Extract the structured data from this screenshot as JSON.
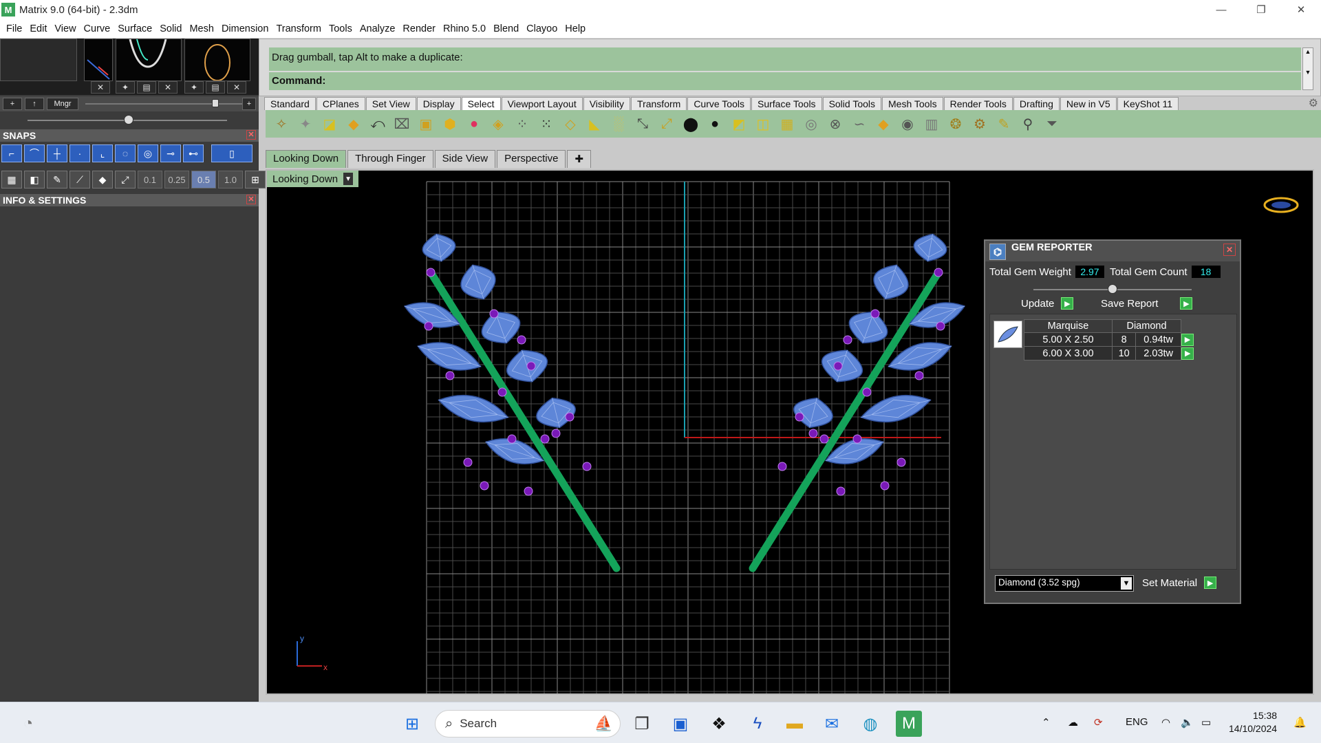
{
  "window": {
    "title": "Matrix 9.0 (64-bit) - 2.3dm",
    "icon_text": "M",
    "minimize": "—",
    "maximize": "❐",
    "close": "✕"
  },
  "menu": [
    "File",
    "Edit",
    "View",
    "Curve",
    "Surface",
    "Solid",
    "Mesh",
    "Dimension",
    "Transform",
    "Tools",
    "Analyze",
    "Render",
    "Rhino 5.0",
    "Blend",
    "Clayoo",
    "Help"
  ],
  "left_panel": {
    "layer_buttons": [
      "+",
      "↑",
      "Mngr"
    ],
    "snaps_title": "SNAPS",
    "snap_values": [
      "0.1",
      "0.25",
      "0.5",
      "1.0"
    ],
    "info_title": "INFO & SETTINGS",
    "close_icon": "✕"
  },
  "command": {
    "history": "Drag gumball, tap Alt to make a duplicate:",
    "prompt": "Command:"
  },
  "toolbar_tabs": [
    "Standard",
    "CPlanes",
    "Set View",
    "Display",
    "Select",
    "Viewport Layout",
    "Visibility",
    "Transform",
    "Curve Tools",
    "Surface Tools",
    "Solid Tools",
    "Mesh Tools",
    "Render Tools",
    "Drafting",
    "New in V5",
    "KeyShot 11"
  ],
  "toolbar_active": "Select",
  "toolbar_icons": [
    "✧",
    "✦",
    "◪",
    "◆",
    "⤺",
    "⌧",
    "▣",
    "⬢",
    "●",
    "◈",
    "⁘",
    "⁙",
    "◇",
    "◣",
    "░",
    "⤡",
    "⤢",
    "⬤",
    "●",
    "◩",
    "◫",
    "▦",
    "◎",
    "⊗",
    "∽",
    "◆",
    "◉",
    "▥",
    "❂",
    "⚙",
    "✎",
    "⚲",
    "⏷"
  ],
  "viewport_tabs": [
    "Looking Down",
    "Through Finger",
    "Side View",
    "Perspective",
    "✚"
  ],
  "viewport_active": "Looking Down",
  "viewport_label": "Looking Down",
  "axis": {
    "y": "y",
    "x": "x"
  },
  "gem_reporter": {
    "title": "GEM REPORTER",
    "total_weight_label": "Total Gem Weight",
    "total_weight": "2.97",
    "total_count_label": "Total Gem Count",
    "total_count": "18",
    "update_label": "Update",
    "save_label": "Save Report",
    "table_headers": [
      "Marquise",
      "Diamond"
    ],
    "rows": [
      {
        "size": "5.00 X 2.50",
        "count": "8",
        "weight": "0.94tw"
      },
      {
        "size": "6.00 X 3.00",
        "count": "10",
        "weight": "2.03tw"
      }
    ],
    "material_select": "Diamond     (3.52 spg)",
    "set_material_label": "Set Material"
  },
  "taskbar": {
    "search_placeholder": "Search",
    "lang": "ENG",
    "time": "15:38",
    "date": "14/10/2024"
  },
  "colors": {
    "command_green": "#9cc39c",
    "gem_blue": "#5e86d8",
    "stem_green": "#14a35a",
    "node_purple": "#7a19b8"
  }
}
